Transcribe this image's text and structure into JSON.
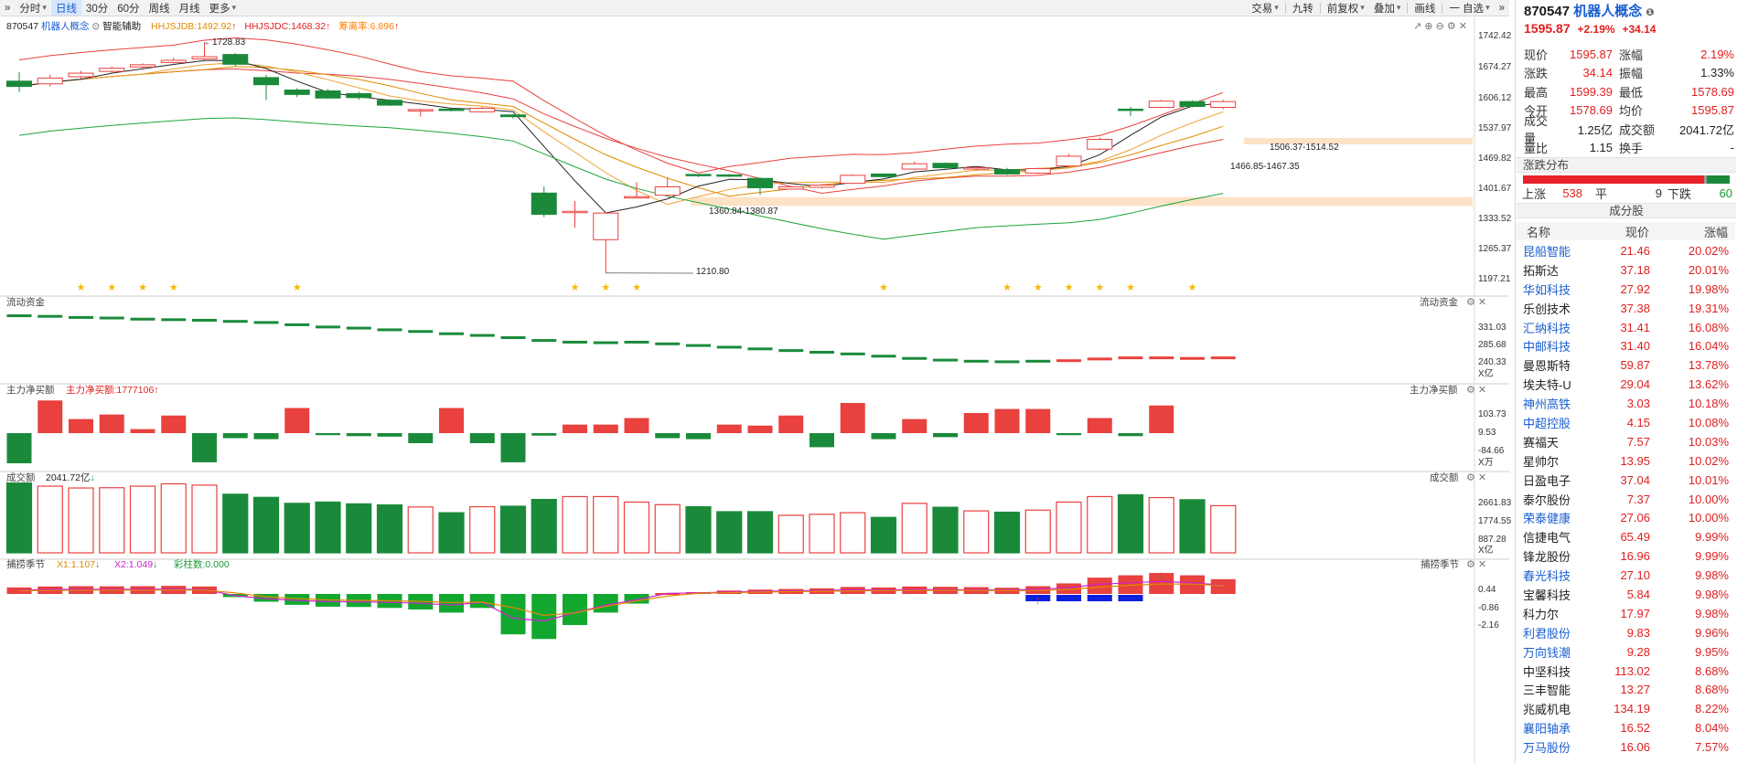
{
  "toolbar": {
    "left": [
      "分时",
      "日线",
      "30分",
      "60分",
      "周线",
      "月线",
      "更多"
    ],
    "right": [
      "交易",
      "九转",
      "前复权",
      "叠加",
      "画线",
      "一 自选"
    ]
  },
  "chart": {
    "code_label": "870547",
    "name_label": "机器人概念",
    "aux_label": "智能辅助",
    "ind1": "HHJSJDB:1492.92",
    "ind2": "HHJSJDC:1468.32",
    "ind3": "筹离率:6.896",
    "price_axis": [
      "1742.42",
      "1674.27",
      "1606.12",
      "1537.97",
      "1469.82",
      "1401.67",
      "1333.52",
      "1265.37",
      "1197.21"
    ],
    "annotations": {
      "high": "1728.83",
      "low": "1210.80",
      "zone1": "1360.84-1380.87",
      "zone2": "1466.85-1467.35",
      "zone3": "1506.37-1514.52"
    },
    "flow_title": "流动资金",
    "flow_axis": [
      "331.03",
      "285.68",
      "240.33"
    ],
    "flow_unit": "X亿",
    "net_title": "主力净买额",
    "net_sub": "主力净买额:1777106",
    "net_axis": [
      "103.73",
      "9.53",
      "-84.66"
    ],
    "net_unit": "X万",
    "vol_title": "成交额",
    "vol_sub": "2041.72亿",
    "vol_axis": [
      "2661.83",
      "1774.55",
      "887.28"
    ],
    "vol_unit": "X亿",
    "season_title": "捕捞季节",
    "season_x1": "X1:1.107",
    "season_x2": "X2:1.049",
    "season_bars": "彩柱数:0.000",
    "season_axis": [
      "0.44",
      "-0.86",
      "-2.16"
    ]
  },
  "candles": [
    [
      1642,
      1630,
      1662,
      1618
    ],
    [
      1636,
      1649,
      1656,
      1630
    ],
    [
      1652,
      1660,
      1665,
      1647
    ],
    [
      1664,
      1671,
      1675,
      1660
    ],
    [
      1674,
      1679,
      1682,
      1670
    ],
    [
      1684,
      1689,
      1695,
      1682
    ],
    [
      1692,
      1697,
      1729,
      1690
    ],
    [
      1702,
      1680,
      1705,
      1676
    ],
    [
      1650,
      1634,
      1656,
      1600
    ],
    [
      1622,
      1612,
      1626,
      1606
    ],
    [
      1620,
      1604,
      1624,
      1602
    ],
    [
      1614,
      1605,
      1618,
      1600
    ],
    [
      1599,
      1588,
      1601,
      1586
    ],
    [
      1577,
      1578,
      1580,
      1562
    ],
    [
      1579,
      1577,
      1580,
      1574
    ],
    [
      1573,
      1581,
      1584,
      1571
    ],
    [
      1566,
      1562,
      1568,
      1558
    ],
    [
      1390,
      1342,
      1405,
      1336
    ],
    [
      1348,
      1349,
      1372,
      1312
    ],
    [
      1285,
      1345,
      1348,
      1210
    ],
    [
      1380,
      1382,
      1414,
      1378
    ],
    [
      1385,
      1404,
      1425,
      1383
    ],
    [
      1432,
      1431,
      1433,
      1426
    ],
    [
      1431,
      1428,
      1433,
      1426
    ],
    [
      1423,
      1402,
      1425,
      1386
    ],
    [
      1399,
      1404,
      1405,
      1398
    ],
    [
      1403,
      1408,
      1410,
      1400
    ],
    [
      1412,
      1430,
      1432,
      1410
    ],
    [
      1433,
      1427,
      1434,
      1425
    ],
    [
      1444,
      1456,
      1461,
      1442
    ],
    [
      1457,
      1447,
      1459,
      1445
    ],
    [
      1445,
      1447,
      1449,
      1441
    ],
    [
      1443,
      1433,
      1447,
      1431
    ],
    [
      1435,
      1445,
      1447,
      1433
    ],
    [
      1451,
      1473,
      1478,
      1449
    ],
    [
      1489,
      1511,
      1515,
      1487
    ],
    [
      1579,
      1576,
      1584,
      1563
    ],
    [
      1583,
      1597,
      1600,
      1581
    ],
    [
      1596,
      1585,
      1599,
      1583
    ],
    [
      1583,
      1596,
      1600,
      1579
    ]
  ],
  "flow": [
    345,
    344,
    342,
    341,
    339,
    338,
    337,
    335,
    333,
    329,
    325,
    323,
    320,
    317,
    313,
    310,
    306,
    301,
    298,
    297,
    298,
    295,
    292,
    289,
    286,
    283,
    280,
    277,
    273,
    269,
    266,
    264,
    263,
    264,
    265,
    268,
    270,
    270,
    269,
    270
  ],
  "net": [
    -60,
    65,
    28,
    37,
    8,
    35,
    -58,
    -10,
    -12,
    50,
    -4,
    -6,
    -7,
    -20,
    50,
    -20,
    -58,
    -5,
    17,
    17,
    30,
    -10,
    -12,
    17,
    15,
    35,
    -28,
    60,
    -12,
    28,
    -8,
    40,
    48,
    48,
    -4,
    30,
    -6,
    55
  ],
  "vol": [
    2680,
    2560,
    2490,
    2500,
    2560,
    2650,
    2600,
    2250,
    2130,
    1900,
    1950,
    1880,
    1840,
    1760,
    1540,
    1770,
    1790,
    2050,
    2160,
    2160,
    1950,
    1850,
    1770,
    1580,
    1580,
    1440,
    1480,
    1540,
    1360,
    1900,
    1750,
    1610,
    1560,
    1640,
    1950,
    2160,
    2230,
    2120,
    2040,
    1810
  ],
  "season": [
    0.42,
    0.48,
    0.5,
    0.49,
    0.5,
    0.52,
    0.48,
    -0.2,
    -0.5,
    -0.7,
    -0.82,
    -0.84,
    -0.9,
    -1.0,
    -1.2,
    -0.9,
    -2.6,
    -2.9,
    -2.0,
    -1.2,
    -0.62,
    0.06,
    0.12,
    0.22,
    0.28,
    0.32,
    0.36,
    0.45,
    0.42,
    0.48,
    0.46,
    0.44,
    0.4,
    0.5,
    0.68,
    1.05,
    1.2,
    1.35,
    1.2,
    0.95
  ],
  "season_pos": [
    false,
    false,
    false,
    false,
    false,
    false,
    false,
    false,
    false,
    false,
    false,
    false,
    false,
    false,
    false,
    false,
    false,
    false,
    false,
    false,
    false,
    false,
    false,
    false,
    false,
    false,
    false,
    false,
    false,
    false,
    false,
    false,
    false,
    true,
    true,
    true,
    true,
    true,
    true,
    true
  ],
  "stars": [
    2,
    3,
    4,
    5,
    9,
    18,
    19,
    20,
    28,
    32,
    33,
    34,
    35,
    36,
    38
  ],
  "side": {
    "code": "870547",
    "name": "机器人概念",
    "price": "1595.87",
    "pct": "+2.19%",
    "chg": "+34.14",
    "rows": [
      [
        "现价",
        "1595.87",
        "red",
        "涨幅",
        "2.19%",
        "red"
      ],
      [
        "涨跌",
        "34.14",
        "red",
        "振幅",
        "1.33%",
        "dark"
      ],
      [
        "最高",
        "1599.39",
        "red",
        "最低",
        "1578.69",
        "red"
      ],
      [
        "今开",
        "1578.69",
        "red",
        "均价",
        "1595.87",
        "red"
      ],
      [
        "成交量",
        "1.25亿",
        "dark",
        "成交额",
        "2041.72亿",
        "dark"
      ],
      [
        "量比",
        "1.15",
        "dark",
        "换手",
        "-",
        "dark"
      ]
    ],
    "dist_title": "涨跌分布",
    "up_label": "上涨",
    "up": "538",
    "flat_label": "平",
    "flat": "9",
    "down_label": "下跌",
    "down": "60",
    "const_title": "成分股",
    "col_name": "名称",
    "col_price": "现价",
    "col_chg": "涨幅",
    "stocks": [
      [
        "昆船智能",
        "21.46",
        "20.02%",
        true
      ],
      [
        "拓斯达",
        "37.18",
        "20.01%",
        false
      ],
      [
        "华如科技",
        "27.92",
        "19.98%",
        true
      ],
      [
        "乐创技术",
        "37.38",
        "19.31%",
        false
      ],
      [
        "汇纳科技",
        "31.41",
        "16.08%",
        true
      ],
      [
        "中邮科技",
        "31.40",
        "16.04%",
        true
      ],
      [
        "曼恩斯特",
        "59.87",
        "13.78%",
        false
      ],
      [
        "埃夫特-U",
        "29.04",
        "13.62%",
        false
      ],
      [
        "神州高铁",
        "3.03",
        "10.18%",
        true
      ],
      [
        "中超控股",
        "4.15",
        "10.08%",
        true
      ],
      [
        "赛福天",
        "7.57",
        "10.03%",
        false
      ],
      [
        "星帅尔",
        "13.95",
        "10.02%",
        false
      ],
      [
        "日盈电子",
        "37.04",
        "10.01%",
        false
      ],
      [
        "泰尔股份",
        "7.37",
        "10.00%",
        false
      ],
      [
        "荣泰健康",
        "27.06",
        "10.00%",
        true
      ],
      [
        "信捷电气",
        "65.49",
        "9.99%",
        false
      ],
      [
        "锋龙股份",
        "16.96",
        "9.99%",
        false
      ],
      [
        "春光科技",
        "27.10",
        "9.98%",
        true
      ],
      [
        "宝馨科技",
        "5.84",
        "9.98%",
        false
      ],
      [
        "科力尔",
        "17.97",
        "9.98%",
        false
      ],
      [
        "利君股份",
        "9.83",
        "9.96%",
        true
      ],
      [
        "万向钱潮",
        "9.28",
        "9.95%",
        true
      ],
      [
        "中坚科技",
        "113.02",
        "8.68%",
        false
      ],
      [
        "三丰智能",
        "13.27",
        "8.68%",
        false
      ],
      [
        "兆威机电",
        "134.19",
        "8.22%",
        false
      ],
      [
        "襄阳轴承",
        "16.52",
        "8.04%",
        true
      ],
      [
        "万马股份",
        "16.06",
        "7.57%",
        true
      ]
    ]
  },
  "colors": {
    "up": "#e8413e",
    "down": "#1a8a3a",
    "blue": "#1a5fd0",
    "zone": "#fde2c6"
  }
}
